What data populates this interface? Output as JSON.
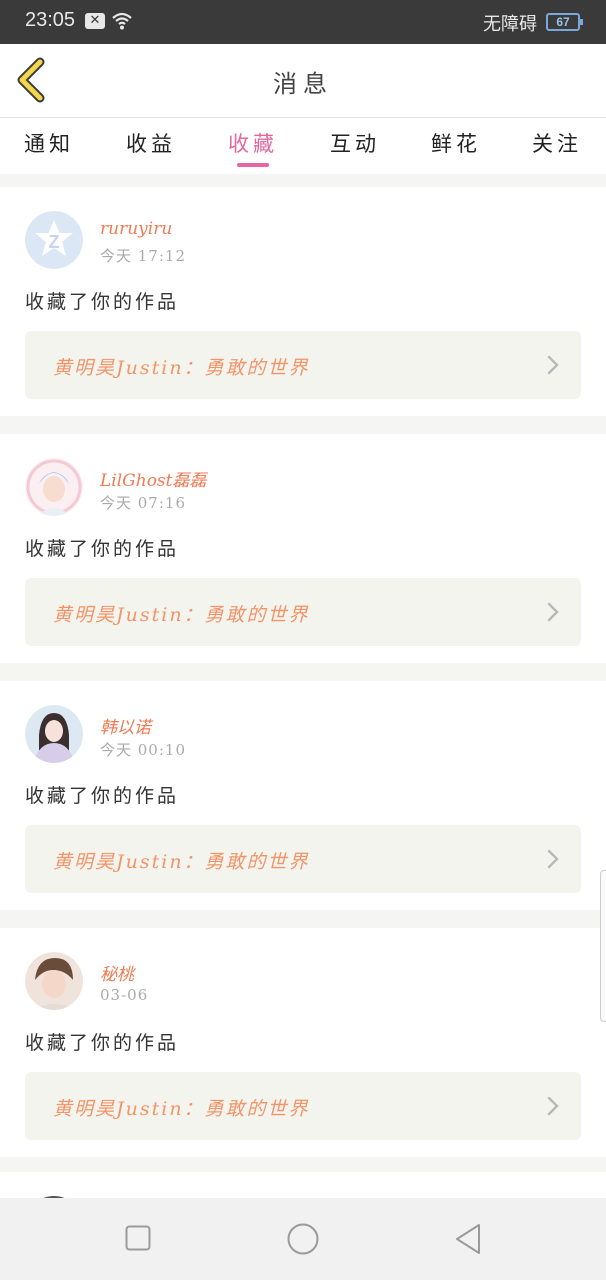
{
  "status_bar": {
    "time": "23:05",
    "notification_icon": "close-box-icon",
    "wifi_icon": "wifi-icon",
    "accessibility_text": "无障碍",
    "battery": "67"
  },
  "header": {
    "back_icon": "chevron-left-icon",
    "title": "消息"
  },
  "tabs": [
    {
      "label": "通知",
      "active": false
    },
    {
      "label": "收益",
      "active": false
    },
    {
      "label": "收藏",
      "active": true
    },
    {
      "label": "互动",
      "active": false
    },
    {
      "label": "鲜花",
      "active": false
    },
    {
      "label": "关注",
      "active": false
    }
  ],
  "colors": {
    "accent": "#e766a0",
    "username": "#f07a52",
    "work_title": "#f39468",
    "work_box_bg": "#f4f4ee"
  },
  "messages": [
    {
      "username": "ruruyiru",
      "time": "今天 17:12",
      "action": "收藏了你的作品",
      "work": "黄明昊Justin：勇敢的世界",
      "avatar": "default-avatar-icon"
    },
    {
      "username": "LilGhost磊磊",
      "time": "今天 07:16",
      "action": "收藏了你的作品",
      "work": "黄明昊Justin：勇敢的世界",
      "avatar": "user-photo-avatar"
    },
    {
      "username": "韩以诺",
      "time": "今天 00:10",
      "action": "收藏了你的作品",
      "work": "黄明昊Justin：勇敢的世界",
      "avatar": "user-photo-avatar"
    },
    {
      "username": "秘桃",
      "time": "03-06",
      "action": "收藏了你的作品",
      "work": "黄明昊Justin：勇敢的世界",
      "avatar": "user-photo-avatar"
    }
  ],
  "nav_bar": {
    "recent_icon": "square-icon",
    "home_icon": "circle-icon",
    "back_icon": "triangle-back-icon"
  }
}
